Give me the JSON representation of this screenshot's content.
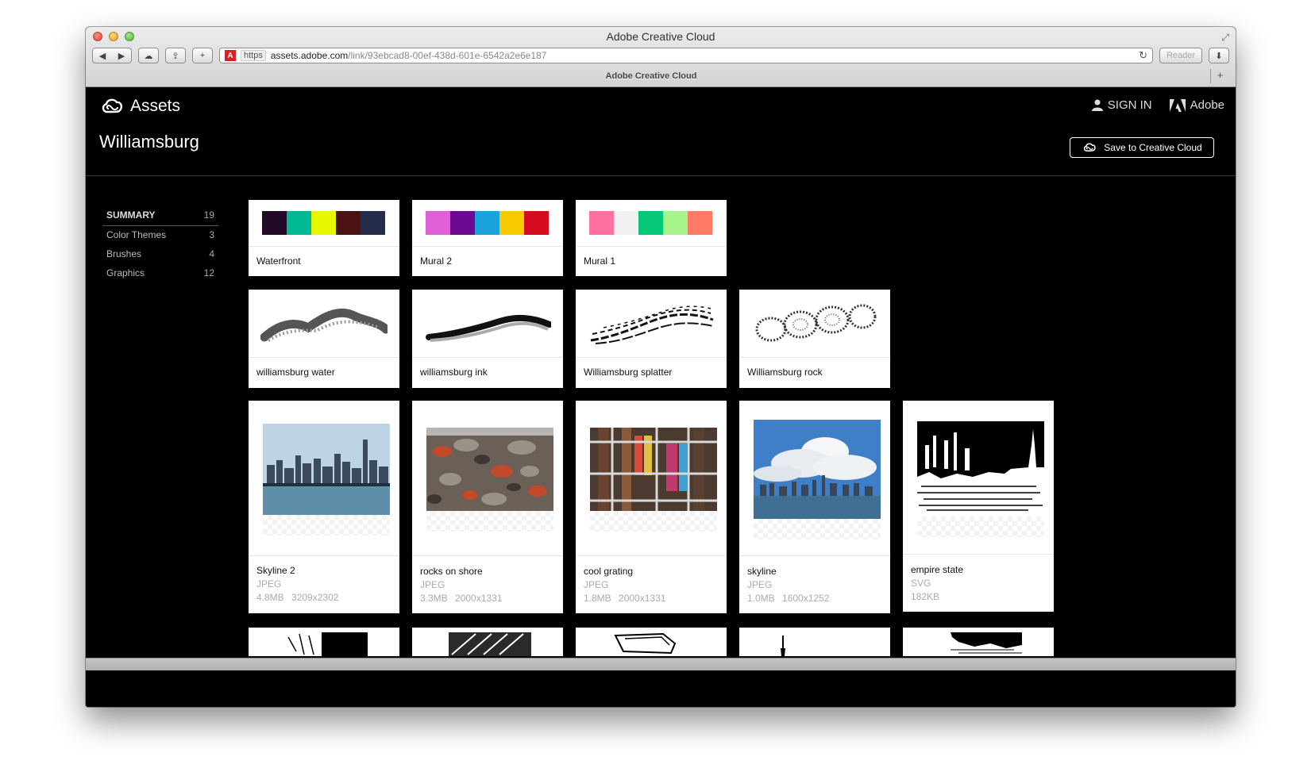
{
  "browser": {
    "window_title": "Adobe Creative Cloud",
    "url_scheme": "https",
    "url_host": "assets.adobe.com",
    "url_path": "/link/93ebcad8-00ef-438d-601e-6542a2e6e187",
    "reader_label": "Reader",
    "tab_title": "Adobe Creative Cloud"
  },
  "header": {
    "app_name": "Assets",
    "sign_in_label": "SIGN IN",
    "adobe_label": "Adobe",
    "page_title": "Williamsburg",
    "save_button_label": "Save to Creative Cloud"
  },
  "sidebar": {
    "items": [
      {
        "label": "SUMMARY",
        "count": "19"
      },
      {
        "label": "Color Themes",
        "count": "3"
      },
      {
        "label": "Brushes",
        "count": "4"
      },
      {
        "label": "Graphics",
        "count": "12"
      }
    ]
  },
  "color_themes": [
    {
      "name": "Waterfront",
      "swatches": [
        "#220a26",
        "#00b894",
        "#e6f700",
        "#4a1212",
        "#232c48"
      ]
    },
    {
      "name": "Mural 2",
      "swatches": [
        "#e060d8",
        "#6a0b91",
        "#19a2dc",
        "#f8c900",
        "#d40c1e"
      ]
    },
    {
      "name": "Mural 1",
      "swatches": [
        "#ff70a2",
        "#f1f1f1",
        "#05c877",
        "#a7f48a",
        "#ff7a62"
      ]
    }
  ],
  "brushes": [
    {
      "name": "williamsburg water",
      "icon": "water-brush-stroke"
    },
    {
      "name": "williamsburg ink",
      "icon": "ink-brush-stroke"
    },
    {
      "name": "Williamsburg splatter",
      "icon": "splatter-brush-stroke"
    },
    {
      "name": "Williamsburg rock",
      "icon": "rock-brush-stroke"
    }
  ],
  "graphics": [
    {
      "name": "Skyline 2",
      "type": "JPEG",
      "size": "4.8MB",
      "dims": "3209x2302"
    },
    {
      "name": "rocks on shore",
      "type": "JPEG",
      "size": "3.3MB",
      "dims": "2000x1331"
    },
    {
      "name": "cool grating",
      "type": "JPEG",
      "size": "1.8MB",
      "dims": "2000x1331"
    },
    {
      "name": "skyline",
      "type": "JPEG",
      "size": "1.0MB",
      "dims": "1600x1252"
    },
    {
      "name": "empire state",
      "type": "SVG",
      "size": "182KB",
      "dims": ""
    }
  ],
  "colors": {
    "page_bg": "#000000",
    "adobe_red": "#e31b23"
  }
}
